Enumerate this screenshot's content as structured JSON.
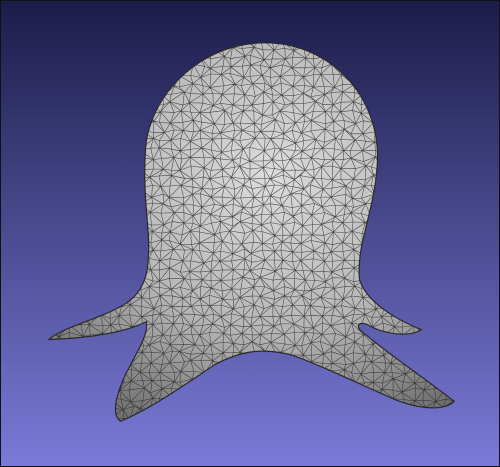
{
  "viewer": {
    "background": {
      "top_color": "#1c1c4a",
      "bottom_color": "#7a7ad8"
    },
    "mesh": {
      "surface_color": "#b6b6b6",
      "highlight_color": "#dcdcdc",
      "shadow_color": "#6c6c6c",
      "edge_color": "#2a2a2a",
      "grid_density": 42
    }
  }
}
